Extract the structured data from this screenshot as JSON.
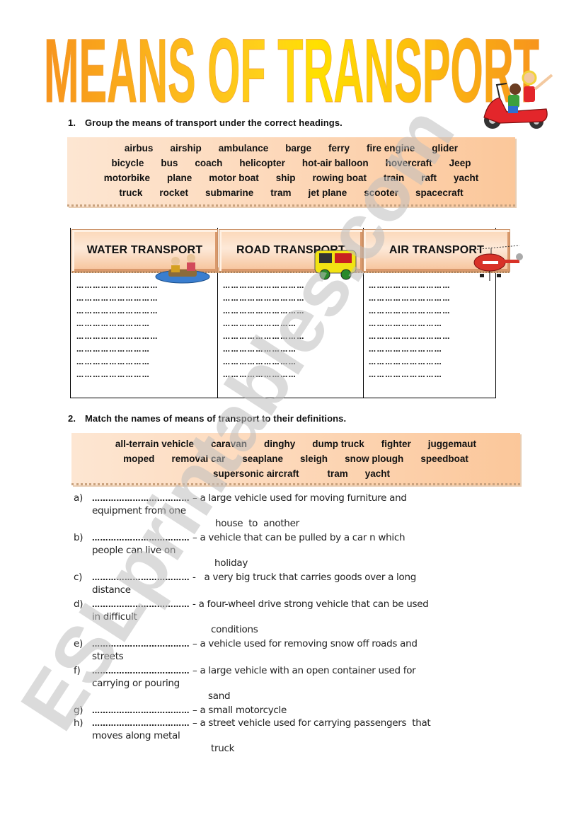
{
  "title": "MEANS OF TRANSPORT",
  "colors": {
    "title_start": "#f7941d",
    "title_mid": "#ffe000",
    "box_light": "#fde6d2",
    "box_dark": "#fbc79a",
    "watermark": "#c8c8c8"
  },
  "section1": {
    "number": "1.",
    "instruction": "Group the means of transport under the correct headings.",
    "word_rows": [
      [
        "airbus",
        "airship",
        "ambulance",
        "barge",
        "ferry",
        "fire engine",
        "glider"
      ],
      [
        "bicycle",
        "bus",
        "coach",
        "helicopter",
        "hot-air balloon",
        "hovercraft",
        "Jeep"
      ],
      [
        "motorbike",
        "plane",
        "motor boat",
        "ship",
        "rowing boat",
        "train",
        "raft",
        "yacht"
      ],
      [
        "truck",
        "rocket",
        "submarine",
        "tram",
        "jet plane",
        "scooter",
        "spacecraft"
      ]
    ],
    "headings": [
      "WATER TRANSPORT",
      "ROAD TRANSPORT",
      "AIR TRANSPORT"
    ],
    "blank_line": "…………………………",
    "blank_line_short": "………………………"
  },
  "section2": {
    "number": "2.",
    "instruction": "Match the names of means of transport to their definitions.",
    "word_rows": [
      [
        "all-terrain vehicle",
        "caravan",
        "dinghy",
        "dump truck",
        "fighter",
        "juggemaut"
      ],
      [
        "moped",
        "removal car",
        "seaplane",
        "sleigh",
        "snow plough",
        "speedboat"
      ],
      [
        "supersonic aircraft",
        "tram",
        "yacht"
      ]
    ],
    "blank": "………………………………",
    "definitions": [
      {
        "letter": "a)",
        "sep": "–",
        "text": "a large vehicle used for moving furniture and",
        "line2": "equipment from one",
        "line3": "house  to  another"
      },
      {
        "letter": "b)",
        "sep": "–",
        "text": "a vehicle that can be pulled by a car n which",
        "line2": "people can live on",
        "line3": "holiday"
      },
      {
        "letter": "c)",
        "sep": "-",
        "text": "  a very big truck that carries goods over a long",
        "line2": "distance",
        "line3": ""
      },
      {
        "letter": "d)",
        "sep": "-",
        "text": "a four-wheel drive strong vehicle that can be used",
        "line2": "in difficult",
        "line3": "conditions"
      },
      {
        "letter": "e)",
        "sep": "–",
        "text": "a vehicle used for removing snow off roads and",
        "line2": "streets",
        "line3": ""
      },
      {
        "letter": "f)",
        "sep": "–",
        "text": "a large vehicle with an open container used for",
        "line2": "carrying or pouring",
        "line3": "sand"
      },
      {
        "letter": "g)",
        "sep": "–",
        "text": "a small motorcycle",
        "line2": "",
        "line3": ""
      },
      {
        "letter": "h)",
        "sep": "–",
        "text": "a street vehicle used for carrying passengers  that",
        "line2": "moves along metal",
        "line3": "truck"
      }
    ]
  },
  "watermark": "ESLprintables.com"
}
